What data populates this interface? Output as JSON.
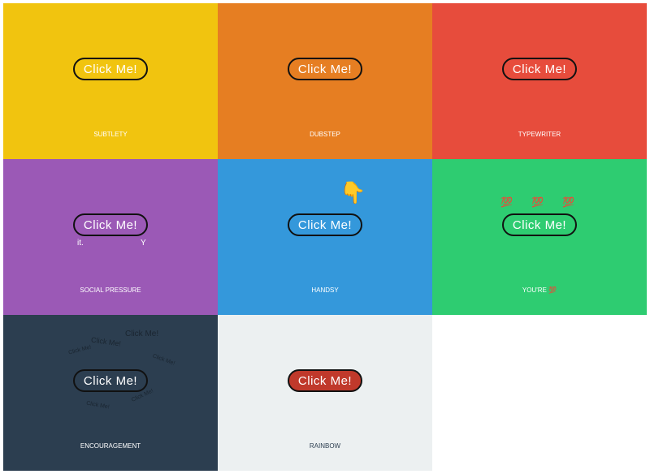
{
  "button_label": "Click Me!",
  "cells": [
    {
      "label": "SUBTLETY",
      "bg": "#f1c40f"
    },
    {
      "label": "DUBSTEP",
      "bg": "#e67e22"
    },
    {
      "label": "TYPEWRITER",
      "bg": "#e74c3c"
    },
    {
      "label": "SOCIAL PRESSURE",
      "bg": "#9b59b6",
      "left_text": "it.",
      "right_text": "Y"
    },
    {
      "label": "HANDSY",
      "bg": "#3498db",
      "hand": "👇"
    },
    {
      "label": "YOU'RE",
      "label_emoji": "💯",
      "bg": "#2ecc71",
      "emoji": "💯"
    },
    {
      "label": "ENCOURAGEMENT",
      "bg": "#2c3e50",
      "ghost": "Click Me!"
    },
    {
      "label": "RAINBOW",
      "bg": "#ecf0f1",
      "button_bg": "#c0392b",
      "label_color": "#2c3e50"
    }
  ]
}
